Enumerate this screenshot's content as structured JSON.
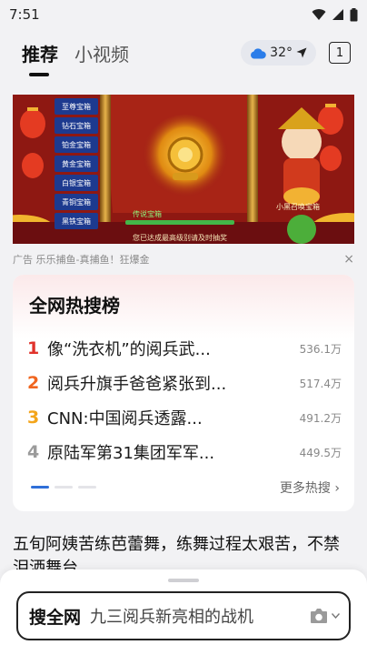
{
  "status_bar": {
    "time": "7:51"
  },
  "nav": {
    "tabs": [
      {
        "label": "推荐"
      },
      {
        "label": "小视频"
      }
    ],
    "weather": {
      "temp": "32°"
    },
    "tab_count": "1"
  },
  "ad": {
    "side_menu": [
      "至尊宝箱",
      "钻石宝箱",
      "铂金宝箱",
      "黄金宝箱",
      "白银宝箱",
      "青铜宝箱",
      "黑铁宝箱"
    ],
    "reward_label": "传说宝箱",
    "reward_note": "您已达成最高级别请及时抽奖",
    "banner_tag": "小黑召唤宝箱",
    "caption": "广告  乐乐捕鱼-真捕鱼！狂爆金",
    "close": "×"
  },
  "hot_list": {
    "title": "全网热搜榜",
    "items": [
      {
        "rank": "1",
        "title": "像“洗衣机”的阅兵武...",
        "count": "536.1万",
        "rank_color": "#e0322b"
      },
      {
        "rank": "2",
        "title": "阅兵升旗手爸爸紧张到...",
        "count": "517.4万",
        "rank_color": "#f0651f"
      },
      {
        "rank": "3",
        "title": "CNN:中国阅兵透露...",
        "count": "491.2万",
        "rank_color": "#f3a51b"
      },
      {
        "rank": "4",
        "title": "原陆军第31集团军军...",
        "count": "449.5万",
        "rank_color": "#9b9b9b"
      }
    ],
    "more": "更多热搜 ›"
  },
  "feed": {
    "headline": "五旬阿姨苦练芭蕾舞，练舞过程太艰苦，不禁泪洒舞台"
  },
  "search": {
    "label": "搜全网",
    "query": "九三阅兵新亮相的战机"
  },
  "colors": {
    "accent_blue": "#2f6fd8",
    "weather_blue": "#2b7de9"
  }
}
